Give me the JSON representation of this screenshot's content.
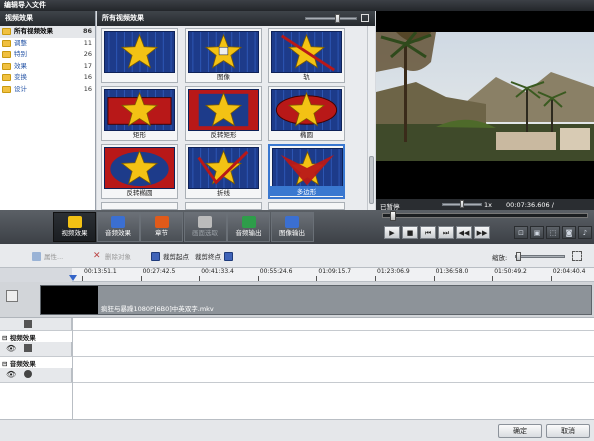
{
  "window": {
    "title": "编辑导入文件"
  },
  "categories": {
    "header": "视频效果",
    "items": [
      {
        "label": "所有视频效果",
        "count": "86",
        "selected": true
      },
      {
        "label": "调整",
        "count": "11"
      },
      {
        "label": "特别",
        "count": "26"
      },
      {
        "label": "效果",
        "count": "17"
      },
      {
        "label": "变换",
        "count": "16"
      },
      {
        "label": "设计",
        "count": "16"
      }
    ]
  },
  "effects": {
    "header": "所有视频效果",
    "tiles": [
      {
        "label": "",
        "style": "star"
      },
      {
        "label": "图像",
        "style": "star-image"
      },
      {
        "label": "轨",
        "style": "star-strike"
      },
      {
        "label": "矩形",
        "style": "rect"
      },
      {
        "label": "反转矩形",
        "style": "rect-inverse"
      },
      {
        "label": "椭圆",
        "style": "ellipse"
      },
      {
        "label": "反转椭圆",
        "style": "ellipse-inverse"
      },
      {
        "label": "折线",
        "style": "polyline"
      },
      {
        "label": "多边形",
        "style": "polygon",
        "selected": true
      }
    ]
  },
  "player": {
    "status": "已暂停",
    "speed": "1x",
    "time": "00:07:36.606 / 02:10:05.310"
  },
  "toolbar": {
    "tools": [
      {
        "label": "视频效果",
        "icon": "video-effects-icon",
        "active": true
      },
      {
        "label": "音频效果",
        "icon": "audio-effects-icon"
      },
      {
        "label": "章节",
        "icon": "chapter-icon"
      },
      {
        "label": "画面选取",
        "icon": "crop-icon",
        "disabled": true
      },
      {
        "label": "音频输出",
        "icon": "audio-output-icon"
      },
      {
        "label": "图像输出",
        "icon": "image-output-icon"
      }
    ]
  },
  "edit_tools": {
    "properties": "属性...",
    "delete": "删除对象",
    "cut_start": "裁剪起点",
    "cut_end": "裁剪终点",
    "zoom_label": "缩放:"
  },
  "ruler": {
    "ticks": [
      "00:13:51.1",
      "00:27:42.5",
      "00:41:33.4",
      "00:55:24.6",
      "01:09:15.7",
      "01:23:06.9",
      "01:36:58.0",
      "01:50:49.2",
      "02:04:40.4"
    ]
  },
  "timeline": {
    "clip_name": "疯狂与暴躁1080P]6B0]中英双字.mkv",
    "video_effects_label": "视频效果",
    "audio_effects_label": "音频效果"
  },
  "dialog": {
    "ok": "确定",
    "cancel": "取消"
  },
  "colors": {
    "tile_bg": "#1d3b8a",
    "star": "#f3c214",
    "red": "#b81818",
    "accent": "#3a78d0"
  }
}
